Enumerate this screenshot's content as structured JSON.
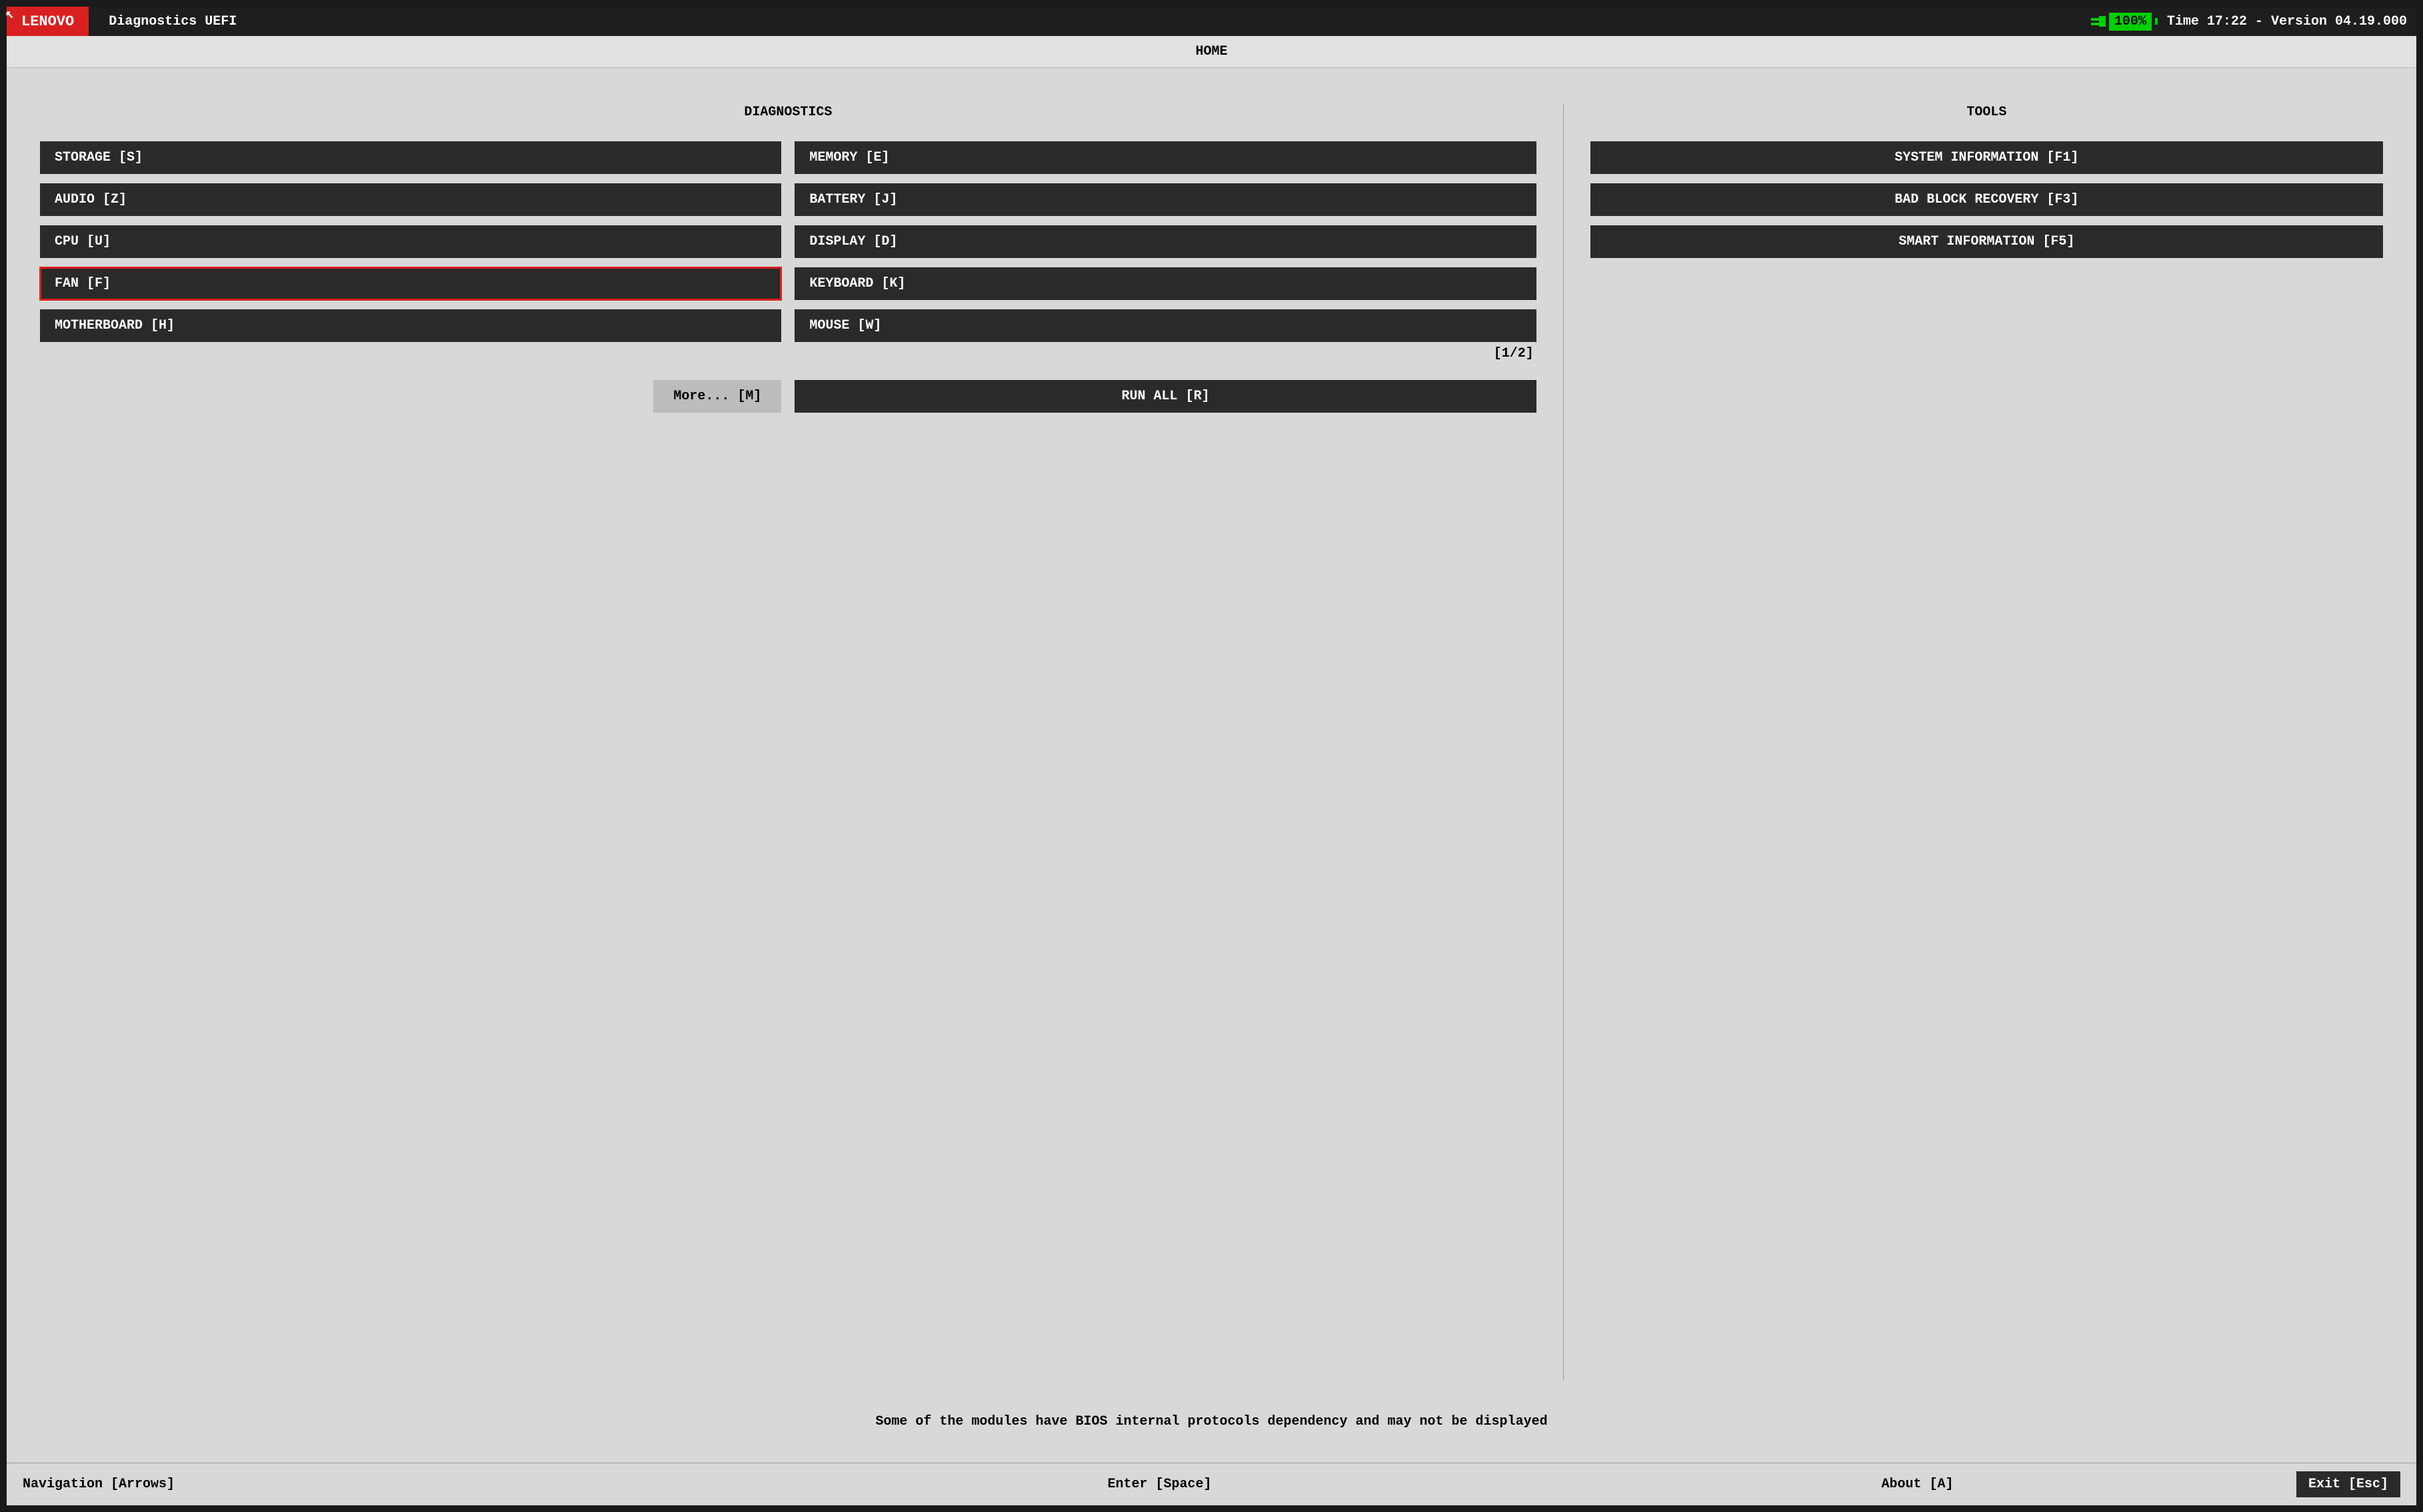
{
  "header": {
    "brand": "LENOVO",
    "title": "Diagnostics UEFI",
    "battery_percent": "100%",
    "time_label": "Time",
    "time_value": "17:22",
    "version_label": "Version",
    "version_value": "04.19.000"
  },
  "home_bar": "HOME",
  "diagnostics": {
    "title": "DIAGNOSTICS",
    "items": [
      {
        "label": "STORAGE [S]",
        "selected": false
      },
      {
        "label": "MEMORY [E]",
        "selected": false
      },
      {
        "label": "AUDIO [Z]",
        "selected": false
      },
      {
        "label": "BATTERY [J]",
        "selected": false
      },
      {
        "label": "CPU [U]",
        "selected": false
      },
      {
        "label": "DISPLAY [D]",
        "selected": false
      },
      {
        "label": "FAN [F]",
        "selected": true
      },
      {
        "label": "KEYBOARD [K]",
        "selected": false
      },
      {
        "label": "MOTHERBOARD [H]",
        "selected": false
      },
      {
        "label": "MOUSE [W]",
        "selected": false
      }
    ],
    "page_indicator": "[1/2]",
    "more_label": "More... [M]",
    "run_all_label": "RUN ALL [R]"
  },
  "tools": {
    "title": "TOOLS",
    "items": [
      {
        "label": "SYSTEM INFORMATION [F1]"
      },
      {
        "label": "BAD BLOCK RECOVERY [F3]"
      },
      {
        "label": "SMART INFORMATION [F5]"
      }
    ]
  },
  "info_message": "Some of the modules have BIOS internal protocols dependency and may not be displayed",
  "footer": {
    "navigation": "Navigation [Arrows]",
    "enter": "Enter [Space]",
    "about": "About [A]",
    "exit": "Exit [Esc]"
  },
  "colors": {
    "brand_red": "#d92020",
    "battery_green": "#00d000",
    "button_dark": "#2a2a28",
    "bg_gray": "#d8d8d8"
  }
}
